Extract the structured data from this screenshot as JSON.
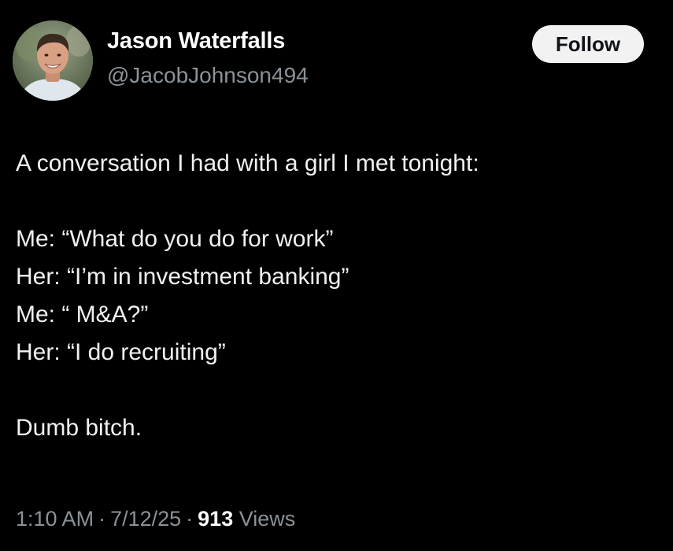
{
  "author": {
    "display_name": "Jason Waterfalls",
    "handle": "@JacobJohnson494",
    "avatar_icon": "profile-photo"
  },
  "follow_button": {
    "label": "Follow"
  },
  "tweet": {
    "lines": [
      "A conversation I had with a girl I met tonight:",
      "",
      "Me: “What do you do for work”",
      "Her: “I’m in investment banking”",
      "Me: “ M&A?”",
      "Her: “I do recruiting”",
      "",
      "Dumb bitch."
    ]
  },
  "meta": {
    "time": "1:10 AM",
    "separator": "·",
    "date": "7/12/25",
    "views_count": "913",
    "views_label": "Views"
  },
  "colors": {
    "background": "#000000",
    "primary_text": "#e7e9ea",
    "secondary_text": "#8b9298",
    "follow_button_bg": "#f2f2f2"
  }
}
